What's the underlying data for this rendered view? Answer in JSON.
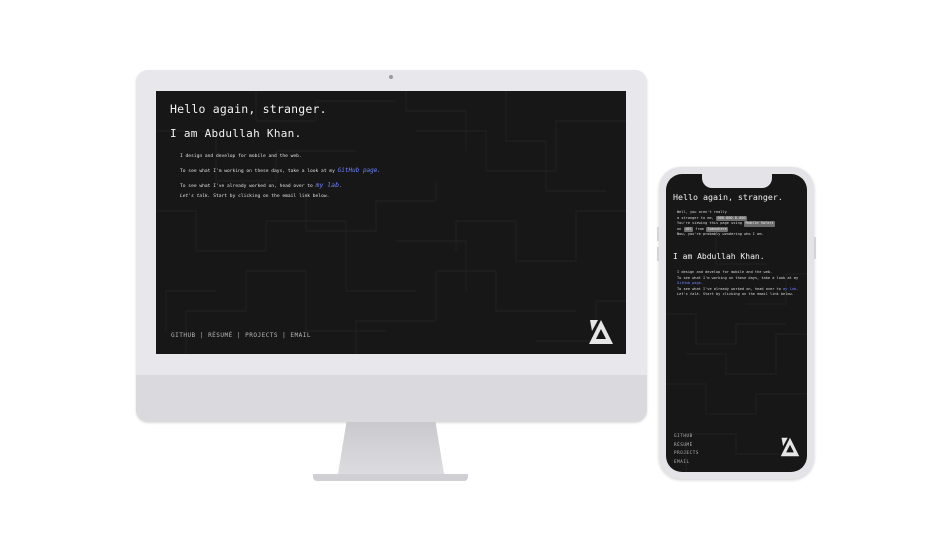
{
  "desktop": {
    "title": "Hello again, stranger.",
    "name": "I am Abdullah Khan.",
    "line1": "I design and develop for mobile and the web.",
    "line2_prefix": "To see what I'm working on these days, take a look at my ",
    "line2_link": "GitHub page",
    "line2_suffix": ".",
    "line3_prefix": "To see what I've already worked on, head over to ",
    "line3_link": "my lab",
    "line3_suffix": ".",
    "line4_emph": "Let's talk.",
    "line4_rest": " Start by clicking on the email link below.",
    "nav": {
      "github": "GITHUB",
      "resume": "RÉSUMÉ",
      "projects": "PROJECTS",
      "email": "EMAIL",
      "separator": "|"
    }
  },
  "mobile": {
    "title": "Hello again, stranger.",
    "intro1": "Well, you aren't really",
    "intro2_prefix": "a stranger to me, ",
    "ip": "000.000.0.000",
    "intro3_prefix": "You're viewing this page using ",
    "browser": "Mobile Safari",
    "intro4_prefix": "on ",
    "os": "iOS",
    "intro4_mid": " from ",
    "location": "Somewhere",
    "intro5": "Now, you're probably wondering who I am.",
    "name": "I am Abdullah Khan.",
    "line1": "I design and develop for mobile and the web.",
    "line2_prefix": "To see what I'm working on these days, take a look at my ",
    "line2_link": "GitHub page",
    "line2_suffix": ".",
    "line3_prefix": "To see what I've already worked on, head over to ",
    "line3_link": "my lab",
    "line3_suffix": ".",
    "line4_emph": "Let's talk.",
    "line4_rest": " Start by clicking on the email link below.",
    "nav": [
      "GITHUB",
      "RÉSUMÉ",
      "PROJECTS",
      "EMAIL"
    ]
  },
  "colors": {
    "screen_bg": "#171717",
    "link": "#6f83ff",
    "text": "#f2f2f2",
    "device_frame": "#e8e8ec"
  }
}
